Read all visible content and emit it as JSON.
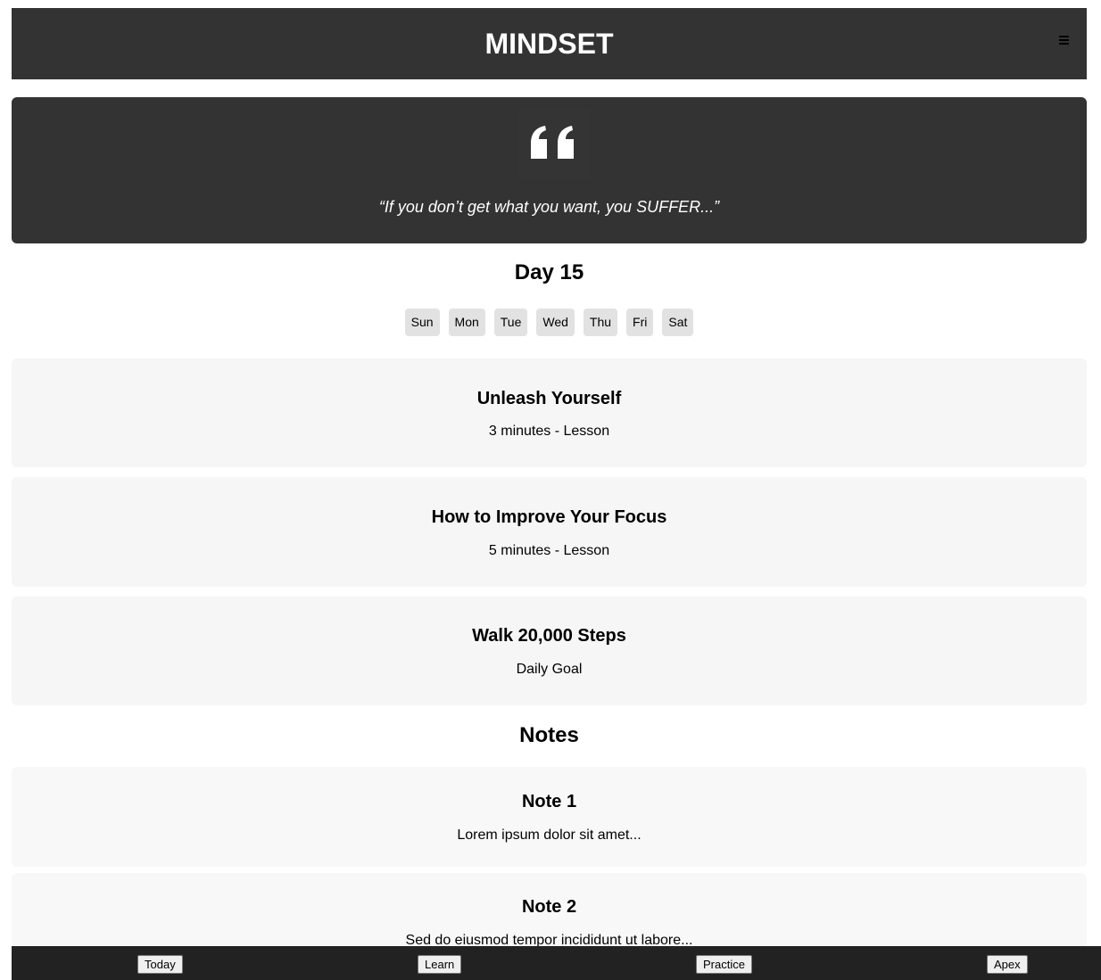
{
  "header": {
    "title": "MINDSET",
    "menu_icon": "hamburger-menu-icon"
  },
  "quote": {
    "icon": "quote-mark-icon",
    "text": "“If you don’t get what you want, you SUFFER...”"
  },
  "day": {
    "title": "Day 15",
    "weekdays": [
      "Sun",
      "Mon",
      "Tue",
      "Wed",
      "Thu",
      "Fri",
      "Sat"
    ]
  },
  "tasks": [
    {
      "title": "Unleash Yourself",
      "subtitle": "3 minutes - Lesson"
    },
    {
      "title": "How to Improve Your Focus",
      "subtitle": "5 minutes - Lesson"
    },
    {
      "title": "Walk 20,000 Steps",
      "subtitle": "Daily Goal"
    }
  ],
  "notes": {
    "title": "Notes",
    "items": [
      {
        "title": "Note 1",
        "body": "Lorem ipsum dolor sit amet..."
      },
      {
        "title": "Note 2",
        "body": "Sed do eiusmod tempor incididunt ut labore..."
      }
    ]
  },
  "bottom_nav": {
    "items": [
      "Today",
      "Learn",
      "Practice",
      "Apex"
    ]
  },
  "colors": {
    "header_bg": "#333333",
    "card_bg": "#f6f6f6",
    "nav_bg": "#222222",
    "day_button_bg": "#e2e2e2"
  }
}
